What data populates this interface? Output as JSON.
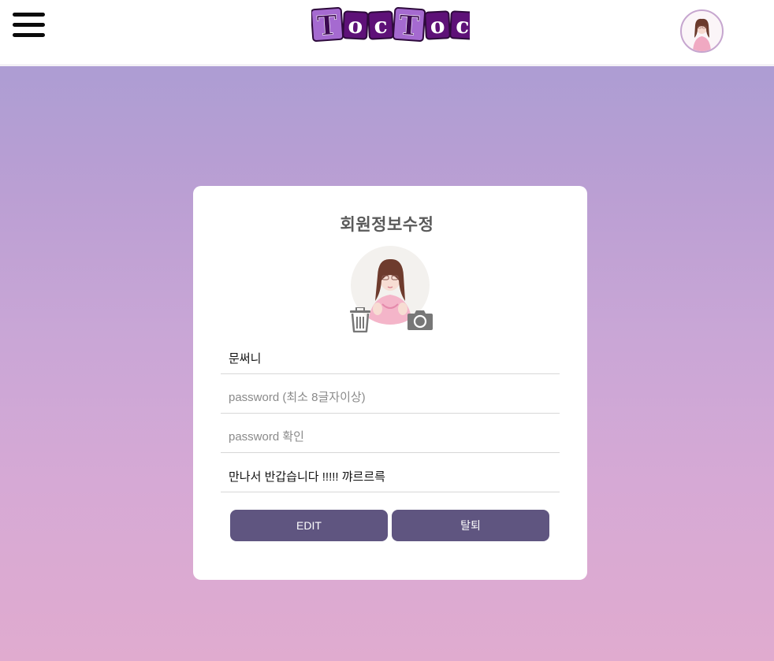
{
  "header": {
    "menu_icon": "hamburger-icon",
    "logo": {
      "text": "TocToc",
      "letters": [
        {
          "char": "T",
          "bg": "#a56ad0",
          "fg": "#3c0a52"
        },
        {
          "char": "o",
          "bg": "#5e1178",
          "fg": "#ffffff"
        },
        {
          "char": "c",
          "bg": "#5e1178",
          "fg": "#ffffff"
        },
        {
          "char": "T",
          "bg": "#a56ad0",
          "fg": "#3c0a52"
        },
        {
          "char": "o",
          "bg": "#5e1178",
          "fg": "#ffffff"
        },
        {
          "char": "c",
          "bg": "#5e1178",
          "fg": "#ffffff"
        }
      ]
    },
    "avatar_icon": "user-avatar"
  },
  "form": {
    "title": "회원정보수정",
    "delete_photo_icon": "trash-icon",
    "upload_photo_icon": "camera-icon",
    "fields": {
      "nickname": {
        "value": "문써니",
        "placeholder": ""
      },
      "password": {
        "value": "",
        "placeholder": "password (최소 8글자이상)"
      },
      "password_confirm": {
        "value": "",
        "placeholder": "password 확인"
      },
      "bio": {
        "value": "만나서 반갑습니다 !!!!! 꺄르르륵",
        "placeholder": ""
      }
    },
    "buttons": {
      "edit": "EDIT",
      "withdraw": "탈퇴"
    }
  },
  "colors": {
    "accent_button": "#5f5580",
    "title_text": "#5a5a5a",
    "gradient_top": "#ad9dd3",
    "gradient_bottom": "#e0abcf"
  }
}
